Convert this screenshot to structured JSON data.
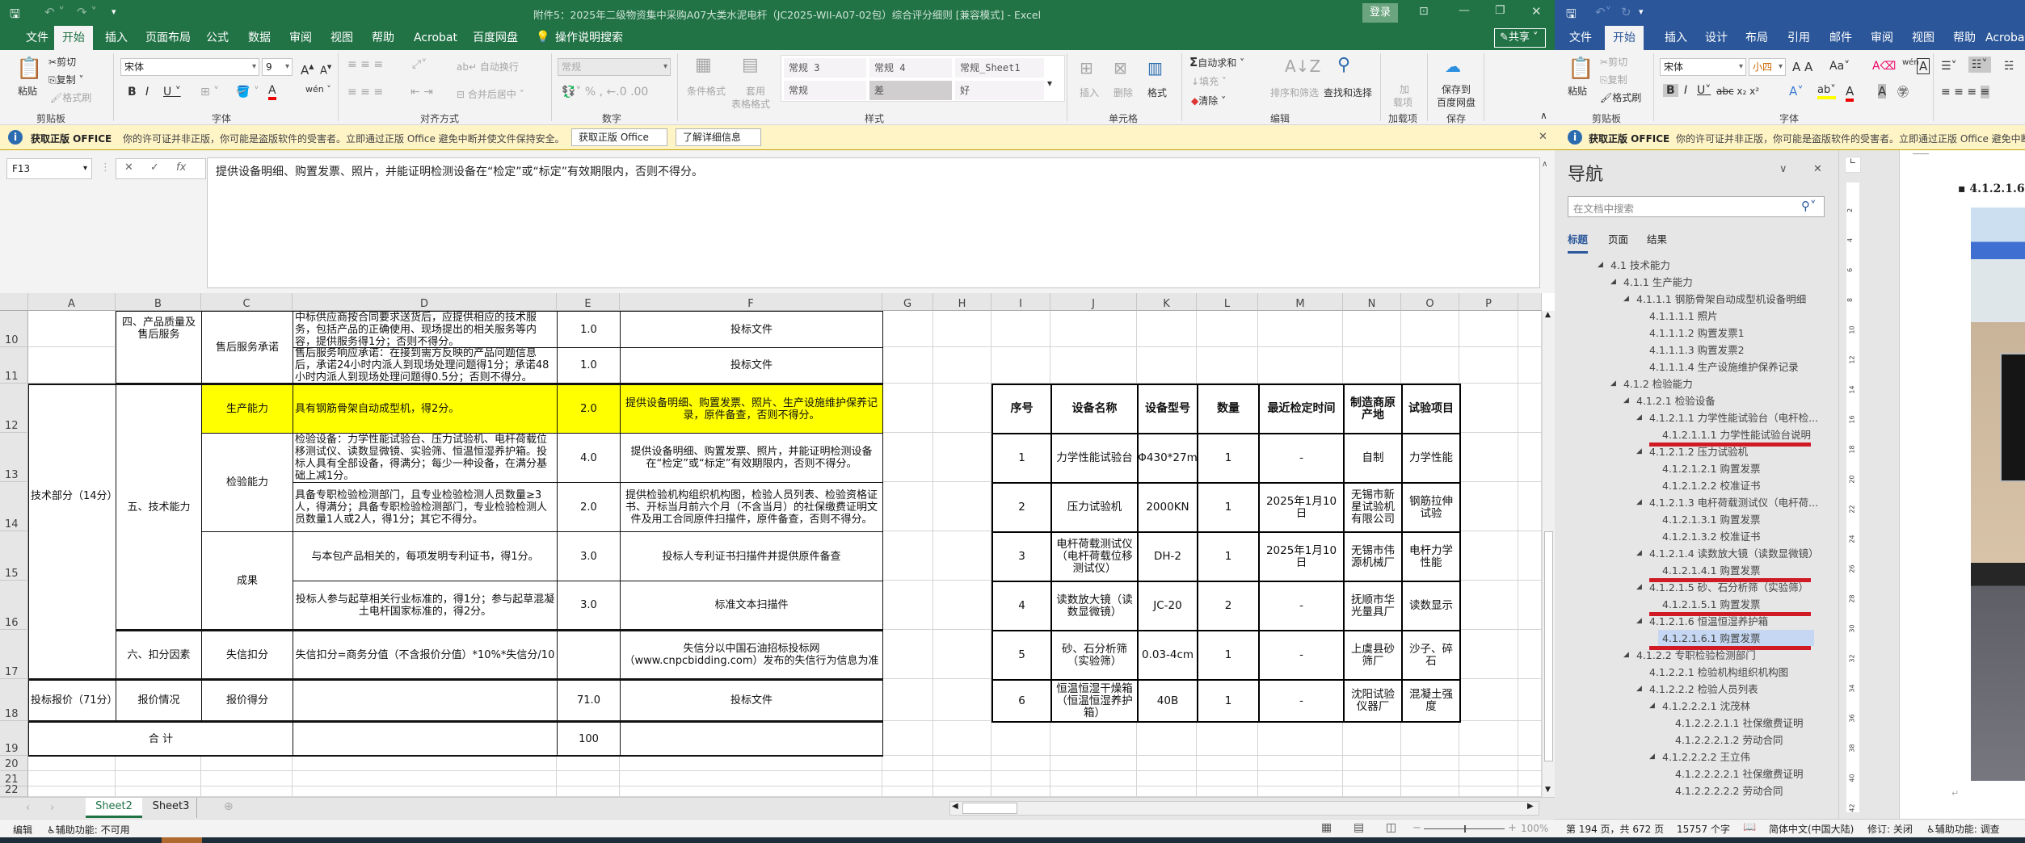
{
  "excel": {
    "title": "附件5：2025年二级物资集中采购A07大类水泥电杆（JC2025-WII-A07-02包）综合评分细则 [兼容模式] - Excel",
    "login": "登录",
    "share": "共享",
    "tabs": [
      "文件",
      "开始",
      "插入",
      "页面布局",
      "公式",
      "数据",
      "审阅",
      "视图",
      "帮助",
      "Acrobat",
      "百度网盘"
    ],
    "tell_me": "操作说明搜索",
    "ribbon": {
      "paste": "粘贴",
      "cut": "剪切",
      "copy": "复制",
      "format_painter": "格式刷",
      "font_name": "宋体",
      "font_size": "9",
      "wrap_text": "自动换行",
      "merge_center": "合并后居中",
      "number_format": "常规",
      "conditional_format": "条件格式",
      "table_format_1": "套用",
      "table_format_2": "表格格式",
      "styles": [
        "常规 3",
        "常规 4",
        "常规_Sheet1",
        "常规",
        "差",
        "好"
      ],
      "insert": "插入",
      "delete": "删除",
      "format": "格式",
      "autosum": "自动求和",
      "fill": "填充",
      "clear": "清除",
      "sort_filter": "排序和筛选",
      "find_select": "查找和选择",
      "addins": "加载项",
      "addins_short_1": "加",
      "addins_short_2": "载项",
      "save_baidu_1": "保存到",
      "save_baidu_2": "百度网盘",
      "groups": [
        "剪贴板",
        "字体",
        "对齐方式",
        "数字",
        "样式",
        "单元格",
        "编辑",
        "加载项",
        "保存"
      ]
    },
    "infobar": {
      "title": "获取正版 OFFICE",
      "message": "你的许可证并非正版，你可能是盗版软件的受害者。立即通过正版 Office 避免中断并使文件保持安全。",
      "btn_get": "获取正版 Office",
      "btn_learn": "了解详细信息"
    },
    "name_box": "F13",
    "formula": "提供设备明细、购置发票、照片，并能证明检测设备在“检定”或“标定”有效期限内，否则不得分。",
    "columns": [
      "A",
      "B",
      "C",
      "D",
      "E",
      "F",
      "G",
      "H",
      "I",
      "J",
      "K",
      "L",
      "M",
      "N",
      "O",
      "P"
    ],
    "rows": [
      "10",
      "11",
      "12",
      "13",
      "14",
      "15",
      "16",
      "17",
      "18",
      "19",
      "20",
      "21",
      "22"
    ],
    "sheet_tabs": [
      "Sheet2",
      "Sheet3"
    ],
    "active_sheet": "Sheet2",
    "status": {
      "mode": "编辑",
      "accessibility": "辅助功能: 不可用",
      "zoom": "100%"
    },
    "colors": {
      "brand": "#217346",
      "highlight": "#ffff00"
    }
  },
  "sheet": {
    "cells": [
      {
        "ref": "B10:B11",
        "text": "四、产品质量及售后服务",
        "valign": "top"
      },
      {
        "ref": "C10:C11",
        "text": "售后服务承诺"
      },
      {
        "ref": "D10",
        "text": "中标供应商按合同要求送货后，应提供相应的技术服务，包括产品的正确使用、现场提出的相关服务等内容，提供服务得1分；否则不得分。",
        "align": "left"
      },
      {
        "ref": "E10",
        "text": "1.0"
      },
      {
        "ref": "F10",
        "text": "投标文件"
      },
      {
        "ref": "D11",
        "text": "售后服务响应承诺：在接到需方反映的产品问题信息后，承诺24小时内派人到现场处理问题得1分；承诺48小时内派人到现场处理问题得0.5分；否则不得分。",
        "align": "left"
      },
      {
        "ref": "E11",
        "text": "1.0"
      },
      {
        "ref": "F11",
        "text": "投标文件"
      },
      {
        "ref": "A12:A17",
        "text": "技术部分（14分）"
      },
      {
        "ref": "B12:B16",
        "text": "五、技术能力"
      },
      {
        "ref": "C12",
        "text": "生产能力",
        "fill": "yellow"
      },
      {
        "ref": "D12",
        "text": "具有钢筋骨架自动成型机，得2分。",
        "align": "left",
        "fill": "yellow"
      },
      {
        "ref": "E12",
        "text": "2.0",
        "fill": "yellow"
      },
      {
        "ref": "F12",
        "text": "提供设备明细、购置发票、照片、生产设施维护保养记录，原件备查，否则不得分。",
        "fill": "yellow"
      },
      {
        "ref": "C13:C14",
        "text": "检验能力"
      },
      {
        "ref": "D13",
        "text": "检验设备：力学性能试验台、压力试验机、电杆荷载位移测试仪、读数显微镜、实验筛、恒温恒湿养护箱。投标人具有全部设备，得满分；每少一种设备，在满分基础上减1分。",
        "align": "left"
      },
      {
        "ref": "E13",
        "text": "4.0"
      },
      {
        "ref": "F13",
        "text": "提供设备明细、购置发票、照片，并能证明检测设备在“检定”或“标定”有效期限内，否则不得分。"
      },
      {
        "ref": "D14",
        "text": "具备专职检验检测部门，且专业检验检测人员数量≥3人，得满分；具备专职检验检测部门，专业检验检测人员数量1人或2人，得1分；其它不得分。",
        "align": "left"
      },
      {
        "ref": "E14",
        "text": "2.0"
      },
      {
        "ref": "F14",
        "text": "提供检验机构组织机构图，检验人员列表、检验资格证书、开标当月前六个月（不含当月）的社保缴费证明文件及用工合同原件扫描件，原件备查，否则不得分。"
      },
      {
        "ref": "C15:C16",
        "text": "成果"
      },
      {
        "ref": "D15",
        "text": "与本包产品相关的，每项发明专利证书，得1分。"
      },
      {
        "ref": "E15",
        "text": "3.0"
      },
      {
        "ref": "F15",
        "text": "投标人专利证书扫描件并提供原件备查"
      },
      {
        "ref": "D16",
        "text": "投标人参与起草相关行业标准的，得1分；参与起草混凝土电杆国家标准的，得2分。"
      },
      {
        "ref": "E16",
        "text": "3.0"
      },
      {
        "ref": "F16",
        "text": "标准文本扫描件"
      },
      {
        "ref": "B17",
        "text": "六、扣分因素"
      },
      {
        "ref": "C17",
        "text": "失信扣分"
      },
      {
        "ref": "D17",
        "text": "失信扣分=商务分值（不含报价分值）*10%*失信分/10"
      },
      {
        "ref": "E17",
        "text": ""
      },
      {
        "ref": "F17",
        "text": "失信分以中国石油招标投标网（www.cnpcbidding.com）发布的失信行为信息为准"
      },
      {
        "ref": "A18",
        "text": "投标报价（71分）"
      },
      {
        "ref": "B18",
        "text": "报价情况"
      },
      {
        "ref": "C18",
        "text": "报价得分"
      },
      {
        "ref": "D18",
        "text": ""
      },
      {
        "ref": "E18",
        "text": "71.0"
      },
      {
        "ref": "F18",
        "text": "投标文件"
      },
      {
        "ref": "A19:C19",
        "text": "合    计"
      },
      {
        "ref": "D19",
        "text": ""
      },
      {
        "ref": "E19",
        "text": "100"
      },
      {
        "ref": "F19",
        "text": ""
      }
    ],
    "equipment": {
      "headers": [
        "序号",
        "设备名称",
        "设备型号",
        "数量",
        "最近检定时间",
        "制造商原产地",
        "试验项目"
      ],
      "rows": [
        [
          "1",
          "力学性能试验台",
          "Φ430*27m",
          "1",
          "-",
          "自制",
          "力学性能"
        ],
        [
          "2",
          "压力试验机",
          "2000KN",
          "1",
          "2025年1月10日",
          "无锡市新星试验机有限公司",
          "钢筋拉伸试验"
        ],
        [
          "3",
          "电杆荷载测试仪（电杆荷载位移测试仪）",
          "DH-2",
          "1",
          "2025年1月10日",
          "无锡市伟源机械厂",
          "电杆力学性能"
        ],
        [
          "4",
          "读数放大镜（读数显微镜）",
          "JC-20",
          "2",
          "-",
          "抚顺市华光量具厂",
          "读数显示"
        ],
        [
          "5",
          "砂、石分析筛（实验筛）",
          "0.03-4cm",
          "1",
          "-",
          "上虞县砂筛厂",
          "沙子、碎石"
        ],
        [
          "6",
          "恒温恒湿干燥箱（恒温恒湿养护箱）",
          "40B",
          "1",
          "-",
          "沈阳试验仪器厂",
          "混凝土强度"
        ]
      ]
    }
  },
  "word": {
    "tabs": [
      "文件",
      "开始",
      "插入",
      "设计",
      "布局",
      "引用",
      "邮件",
      "审阅",
      "视图",
      "帮助",
      "Acrobat"
    ],
    "ribbon": {
      "paste": "粘贴",
      "cut": "剪切",
      "copy": "复制",
      "format_painter": "格式刷",
      "font_name": "宋体",
      "font_size": "小四",
      "groups": [
        "剪贴板",
        "字体"
      ]
    },
    "infobar": {
      "title": "获取正版 OFFICE",
      "message": "你的许可证并非正版，你可能是盗版软件的受害者。立即通过正版 Office 避免中断"
    },
    "nav": {
      "title": "导航",
      "search_placeholder": "在文档中搜索",
      "tabs": [
        "标题",
        "页面",
        "结果"
      ],
      "items": [
        {
          "level": 0,
          "exp": true,
          "text": "4.1 技术能力"
        },
        {
          "level": 1,
          "exp": true,
          "text": "4.1.1 生产能力"
        },
        {
          "level": 2,
          "exp": true,
          "text": "4.1.1.1 钢筋骨架自动成型机设备明细"
        },
        {
          "level": 3,
          "exp": false,
          "text": "4.1.1.1.1 照片"
        },
        {
          "level": 3,
          "exp": false,
          "text": "4.1.1.1.2 购置发票1"
        },
        {
          "level": 3,
          "exp": false,
          "text": "4.1.1.1.3 购置发票2"
        },
        {
          "level": 3,
          "exp": false,
          "text": "4.1.1.1.4 生产设施维护保养记录"
        },
        {
          "level": 1,
          "exp": true,
          "text": "4.1.2 检验能力"
        },
        {
          "level": 2,
          "exp": true,
          "text": "4.1.2.1 检验设备"
        },
        {
          "level": 3,
          "exp": true,
          "text": "4.1.2.1.1 力学性能试验台（电杆检..."
        },
        {
          "level": 4,
          "exp": false,
          "text": "4.1.2.1.1.1 力学性能试验台说明",
          "marked": true
        },
        {
          "level": 3,
          "exp": true,
          "text": "4.1.2.1.2 压力试验机"
        },
        {
          "level": 4,
          "exp": false,
          "text": "4.1.2.1.2.1 购置发票"
        },
        {
          "level": 4,
          "exp": false,
          "text": "4.1.2.1.2.2 校准证书"
        },
        {
          "level": 3,
          "exp": true,
          "text": "4.1.2.1.3 电杆荷载测试仪（电杆荷..."
        },
        {
          "level": 4,
          "exp": false,
          "text": "4.1.2.1.3.1 购置发票"
        },
        {
          "level": 4,
          "exp": false,
          "text": "4.1.2.1.3.2 校准证书"
        },
        {
          "level": 3,
          "exp": true,
          "text": "4.1.2.1.4 读数放大镜（读数显微镜）"
        },
        {
          "level": 4,
          "exp": false,
          "text": "4.1.2.1.4.1 购置发票",
          "marked": true
        },
        {
          "level": 3,
          "exp": true,
          "text": "4.1.2.1.5 砂、石分析筛（实验筛）"
        },
        {
          "level": 4,
          "exp": false,
          "text": "4.1.2.1.5.1 购置发票",
          "marked": true
        },
        {
          "level": 3,
          "exp": true,
          "text": "4.1.2.1.6 恒温恒湿养护箱"
        },
        {
          "level": 4,
          "exp": false,
          "text": "4.1.2.1.6.1 购置发票",
          "selected": true,
          "marked": true
        },
        {
          "level": 2,
          "exp": true,
          "text": "4.1.2.2 专职检验检测部门"
        },
        {
          "level": 3,
          "exp": false,
          "text": "4.1.2.2.1 检验机构组织机构图"
        },
        {
          "level": 3,
          "exp": true,
          "text": "4.1.2.2.2 检验人员列表"
        },
        {
          "level": 4,
          "exp": true,
          "text": "4.1.2.2.2.1 沈茂林"
        },
        {
          "level": 5,
          "exp": false,
          "text": "4.1.2.2.2.1.1 社保缴费证明"
        },
        {
          "level": 5,
          "exp": false,
          "text": "4.1.2.2.2.1.2 劳动合同"
        },
        {
          "level": 4,
          "exp": true,
          "text": "4.1.2.2.2.2 王立伟"
        },
        {
          "level": 5,
          "exp": false,
          "text": "4.1.2.2.2.2.1 社保缴费证明"
        },
        {
          "level": 5,
          "exp": false,
          "text": "4.1.2.2.2.2.2 劳动合同"
        }
      ]
    },
    "doc_heading": "4.1.2.1.6",
    "ruler_marks": [
      "2",
      "4",
      "6",
      "8",
      "10",
      "12",
      "14",
      "16",
      "18",
      "20",
      "22",
      "24",
      "26",
      "28",
      "30",
      "32",
      "34",
      "36",
      "38",
      "40",
      "42"
    ],
    "status": {
      "page": "第 194 页，共 672 页",
      "words": "15757 个字",
      "language": "简体中文(中国大陆)",
      "track": "修订: 关闭",
      "accessibility": "辅助功能: 调查"
    },
    "colors": {
      "brand": "#2b579a",
      "annotation": "#d01a24",
      "selected": "#c5d7f2"
    }
  }
}
